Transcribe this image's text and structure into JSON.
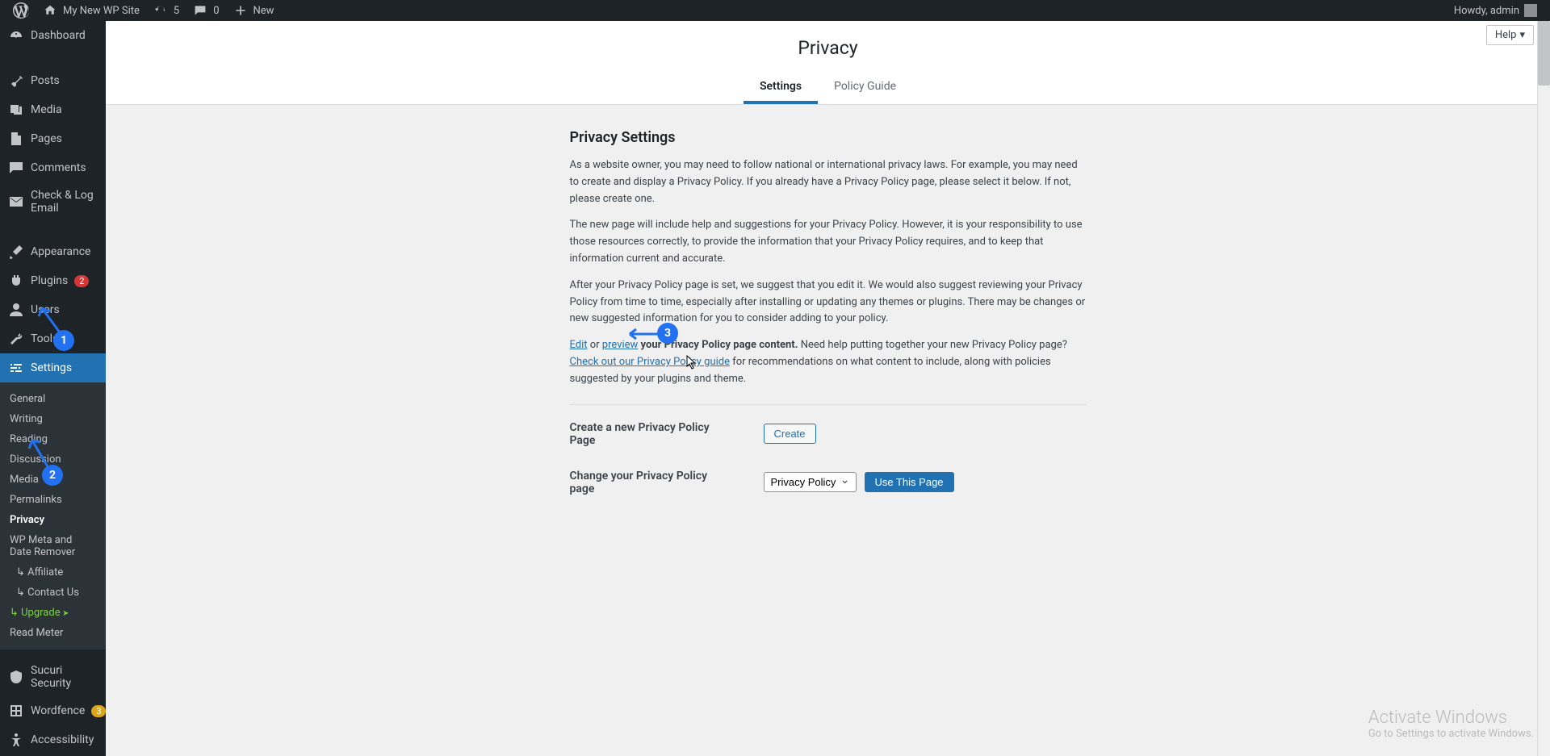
{
  "adminbar": {
    "site_name": "My New WP Site",
    "updates_count": "5",
    "comments_count": "0",
    "new_label": "New",
    "howdy": "Howdy, admin"
  },
  "sidebar": {
    "items": [
      {
        "label": "Dashboard",
        "icon": "dashboard"
      },
      {
        "label": "Posts",
        "icon": "pin"
      },
      {
        "label": "Media",
        "icon": "media"
      },
      {
        "label": "Pages",
        "icon": "page"
      },
      {
        "label": "Comments",
        "icon": "comment"
      },
      {
        "label": "Check & Log Email",
        "icon": "mail"
      },
      {
        "label": "Appearance",
        "icon": "brush"
      },
      {
        "label": "Plugins",
        "icon": "plug",
        "badge": "2"
      },
      {
        "label": "Users",
        "icon": "user"
      },
      {
        "label": "Tools",
        "icon": "wrench"
      },
      {
        "label": "Settings",
        "icon": "sliders",
        "active": true
      },
      {
        "label": "Sucuri Security",
        "icon": "shield"
      },
      {
        "label": "Wordfence",
        "icon": "wf",
        "badge": "3",
        "badge_color": "orange"
      },
      {
        "label": "Accessibility",
        "icon": "accessibility"
      }
    ],
    "settings_sub": [
      {
        "label": "General"
      },
      {
        "label": "Writing"
      },
      {
        "label": "Reading"
      },
      {
        "label": "Discussion"
      },
      {
        "label": "Media"
      },
      {
        "label": "Permalinks"
      },
      {
        "label": "Privacy",
        "active": true
      },
      {
        "label": "WP Meta and Date Remover"
      },
      {
        "label": "Affiliate",
        "indent": true
      },
      {
        "label": "Contact Us",
        "indent": true
      },
      {
        "label": "Upgrade",
        "upgrade": true
      },
      {
        "label": "Read Meter"
      }
    ]
  },
  "help_label": "Help",
  "page": {
    "title": "Privacy",
    "tabs": [
      {
        "label": "Settings",
        "active": true
      },
      {
        "label": "Policy Guide"
      }
    ],
    "section_title": "Privacy Settings",
    "para1": "As a website owner, you may need to follow national or international privacy laws. For example, you may need to create and display a Privacy Policy. If you already have a Privacy Policy page, please select it below. If not, please create one.",
    "para2": "The new page will include help and suggestions for your Privacy Policy. However, it is your responsibility to use those resources correctly, to provide the information that your Privacy Policy requires, and to keep that information current and accurate.",
    "para3": "After your Privacy Policy page is set, we suggest that you edit it. We would also suggest reviewing your Privacy Policy from time to time, especially after installing or updating any themes or plugins. There may be changes or new suggested information for you to consider adding to your policy.",
    "edit_link": "Edit",
    "or_text": " or ",
    "preview_link": "preview",
    "para4_mid": " your Privacy Policy page content. ",
    "para4_help": "Need help putting together your new Privacy Policy page? ",
    "guide_link": "Check out our Privacy Policy guide",
    "para4_end": " for recommendations on what content to include, along with policies suggested by your plugins and theme.",
    "create_label": "Create a new Privacy Policy Page",
    "create_button": "Create",
    "change_label": "Change your Privacy Policy page",
    "select_value": "Privacy Policy",
    "use_button": "Use This Page"
  },
  "callouts": {
    "n1": "1",
    "n2": "2",
    "n3": "3"
  },
  "watermark": {
    "title": "Activate Windows",
    "sub": "Go to Settings to activate Windows."
  }
}
